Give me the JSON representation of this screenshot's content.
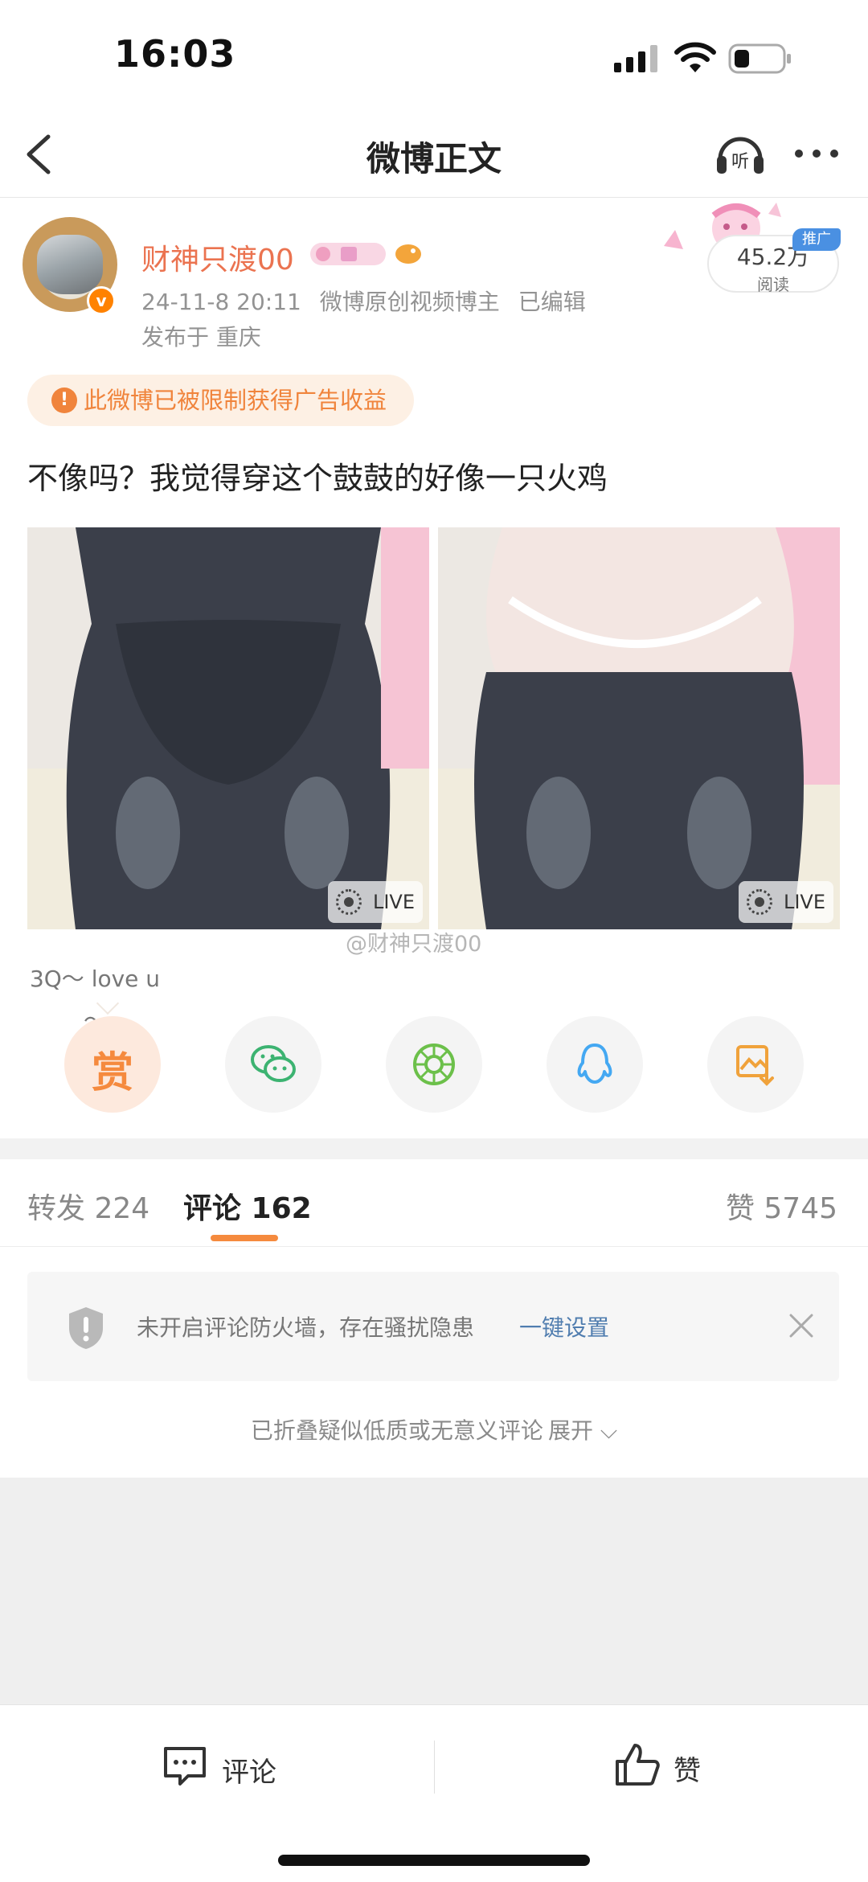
{
  "status_bar": {
    "time": "16:03"
  },
  "nav": {
    "title": "微博正文"
  },
  "author": {
    "name": "财神只渡00",
    "timestamp": "24-11-8 20:11",
    "tag": "微博原创视频博主",
    "edited": "已编辑",
    "location": "发布于 重庆",
    "verified_mark": "v"
  },
  "promo": {
    "read_count": "45.2万",
    "read_label": "阅读",
    "ad_badge": "推广"
  },
  "warning": {
    "icon": "!",
    "text": "此微博已被限制获得广告收益"
  },
  "post": {
    "text": "不像吗？我觉得穿这个鼓鼓的好像一只火鸡"
  },
  "media": {
    "live_badge": "LIVE",
    "watermark": "@财神只渡00",
    "caption": "3Q～ love u～"
  },
  "share": {
    "reward_glyph": "赏",
    "items": [
      "reward-icon",
      "wechat-icon",
      "moments-icon",
      "qq-icon",
      "save-image-icon"
    ]
  },
  "tabs": {
    "repost": "转发 224",
    "comment": "评论 162",
    "like": "赞 5745"
  },
  "notice": {
    "text": "未开启评论防火墙，存在骚扰隐患",
    "link": "一键设置"
  },
  "folded": {
    "text": "已折叠疑似低质或无意义评论",
    "link": "展开 ⌵"
  },
  "bottom_bar": {
    "comment": "评论",
    "like": "赞"
  },
  "colors": {
    "accent_orange": "#f58a3e",
    "name_orange": "#eb7350",
    "link_blue": "#507daf"
  }
}
